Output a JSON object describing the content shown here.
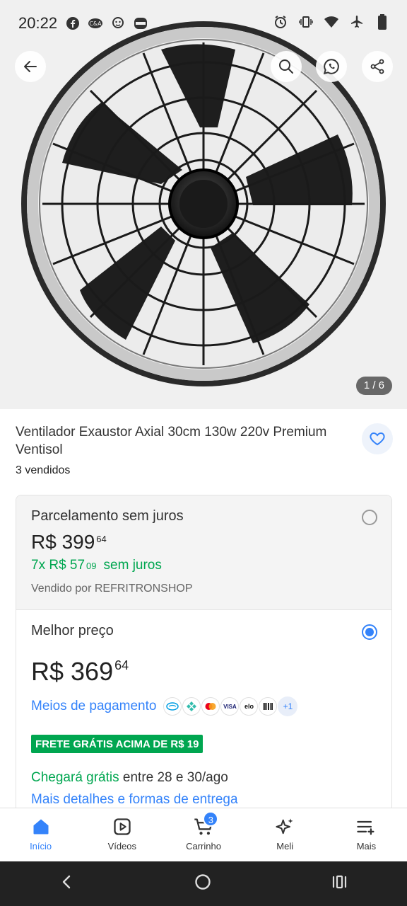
{
  "status_bar": {
    "time": "20:22",
    "icons_left": [
      "facebook-icon",
      "ca-app-icon",
      "monkey-icon",
      "burger-king-icon"
    ],
    "icons_right": [
      "alarm-icon",
      "vibrate-icon",
      "wifi-icon",
      "airplane-icon",
      "battery-icon"
    ]
  },
  "gallery": {
    "counter": "1 / 6"
  },
  "product": {
    "title": "Ventilador Exaustor Axial 30cm 130w 220v Premium Ventisol",
    "sold": "3 vendidos"
  },
  "offer_installments": {
    "heading": "Parcelamento sem juros",
    "price_main": "R$ 399",
    "price_cents": "64",
    "installment_main": "7x R$ 57",
    "installment_cents": "09",
    "installment_note": "sem juros",
    "seller": "Vendido por REFRITRONSHOP"
  },
  "offer_best": {
    "heading": "Melhor preço",
    "price_main": "R$ 369",
    "price_cents": "64",
    "payment_link": "Meios de pagamento",
    "payment_icons": [
      "mercado-pago-icon",
      "pix-icon",
      "mastercard-icon",
      "visa-icon",
      "elo-icon",
      "boleto-icon"
    ],
    "payment_labels": {
      "visa": "VISA",
      "elo": "elo",
      "more": "+1"
    },
    "free_shipping_badge": "FRETE GRÁTIS ACIMA DE R$ 19",
    "delivery_free": "Chegará grátis",
    "delivery_dates": " entre 28 e 30/ago",
    "more_details": "Mais detalhes e formas de entrega"
  },
  "bottom_nav": {
    "items": [
      {
        "label": "Início",
        "active": true
      },
      {
        "label": "Vídeos"
      },
      {
        "label": "Carrinho",
        "badge": "3"
      },
      {
        "label": "Meli"
      },
      {
        "label": "Mais"
      }
    ]
  },
  "colors": {
    "accent": "#3483fa",
    "green": "#00a650"
  }
}
